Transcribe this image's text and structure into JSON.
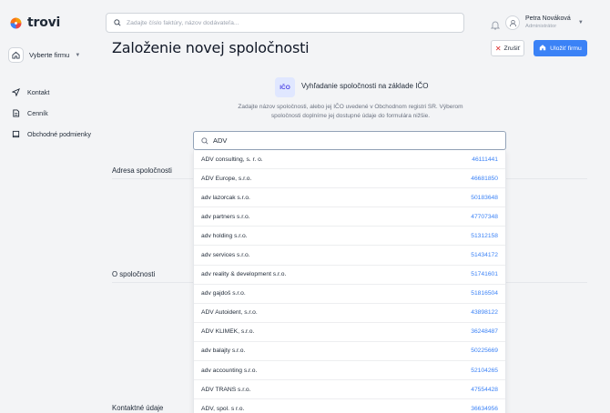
{
  "brand": {
    "name": "trovi"
  },
  "company_select": {
    "label": "Vyberte firmu"
  },
  "nav": [
    {
      "label": "Kontakt",
      "icon": "send-icon"
    },
    {
      "label": "Cenník",
      "icon": "document-icon"
    },
    {
      "label": "Obchodné podmienky",
      "icon": "book-icon"
    }
  ],
  "search": {
    "placeholder": "Zadajte číslo faktúry, názov dodávateľa..."
  },
  "user": {
    "name": "Petra Nováková",
    "role": "Administrátor"
  },
  "page": {
    "title": "Založenie novej spoločnosti"
  },
  "actions": {
    "cancel": "Zrušiť",
    "save": "Uložiť firmu"
  },
  "lookup": {
    "badge": "IČO",
    "title": "Vyhľadanie spoločnosti na základe IČO",
    "description": "Zadajte názov spoločnosti, alebo jej IČO uvedené v Obchodnom registri SR. Výberom spoločnosti doplníme jej dostupné údaje do formulára nižšie.",
    "query": "ADV",
    "results": [
      {
        "name": "ADV consulting, s. r. o.",
        "ico": "46111441"
      },
      {
        "name": "ADV Europe, s.r.o.",
        "ico": "46681850"
      },
      {
        "name": "adv lazorcak s.r.o.",
        "ico": "50183648"
      },
      {
        "name": "adv partners s.r.o.",
        "ico": "47707348"
      },
      {
        "name": "adv holding s.r.o.",
        "ico": "51312158"
      },
      {
        "name": "adv services s.r.o.",
        "ico": "51434172"
      },
      {
        "name": "adv reality & development s.r.o.",
        "ico": "51741601"
      },
      {
        "name": "adv gajdoš s.r.o.",
        "ico": "51816504"
      },
      {
        "name": "ADV Autoident, s.r.o.",
        "ico": "43898122"
      },
      {
        "name": "ADV KLIMEK, s.r.o.",
        "ico": "36248487"
      },
      {
        "name": "adv balajty s.r.o.",
        "ico": "50225669"
      },
      {
        "name": "adv accounting s.r.o.",
        "ico": "52104265"
      },
      {
        "name": "ADV TRANS s.r.o.",
        "ico": "47554428"
      },
      {
        "name": "ADV, spol. s r.o.",
        "ico": "36634956"
      }
    ]
  },
  "sections": {
    "address": "Adresa spoločnosti",
    "about": "O spoločnosti",
    "contact": "Kontaktné údaje"
  },
  "colors": {
    "accent": "#3b82f6",
    "danger": "#dc2626",
    "background": "#f3f4f6"
  }
}
